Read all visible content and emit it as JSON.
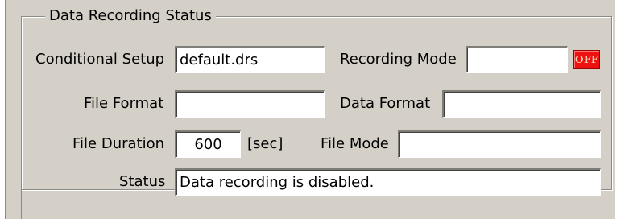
{
  "group": {
    "title": "Data Recording Status"
  },
  "fields": {
    "conditional_setup": {
      "label": "Conditional Setup",
      "value": "default.drs"
    },
    "recording_mode": {
      "label": "Recording Mode",
      "value": ""
    },
    "recording_indicator": {
      "text": "OFF",
      "color": "#ee1111"
    },
    "file_format": {
      "label": "File Format",
      "value": ""
    },
    "data_format": {
      "label": "Data Format",
      "value": ""
    },
    "file_duration": {
      "label": "File Duration",
      "value": "600",
      "unit": "[sec]"
    },
    "file_mode": {
      "label": "File Mode",
      "value": ""
    },
    "status": {
      "label": "Status",
      "value": "Data recording is disabled."
    }
  }
}
